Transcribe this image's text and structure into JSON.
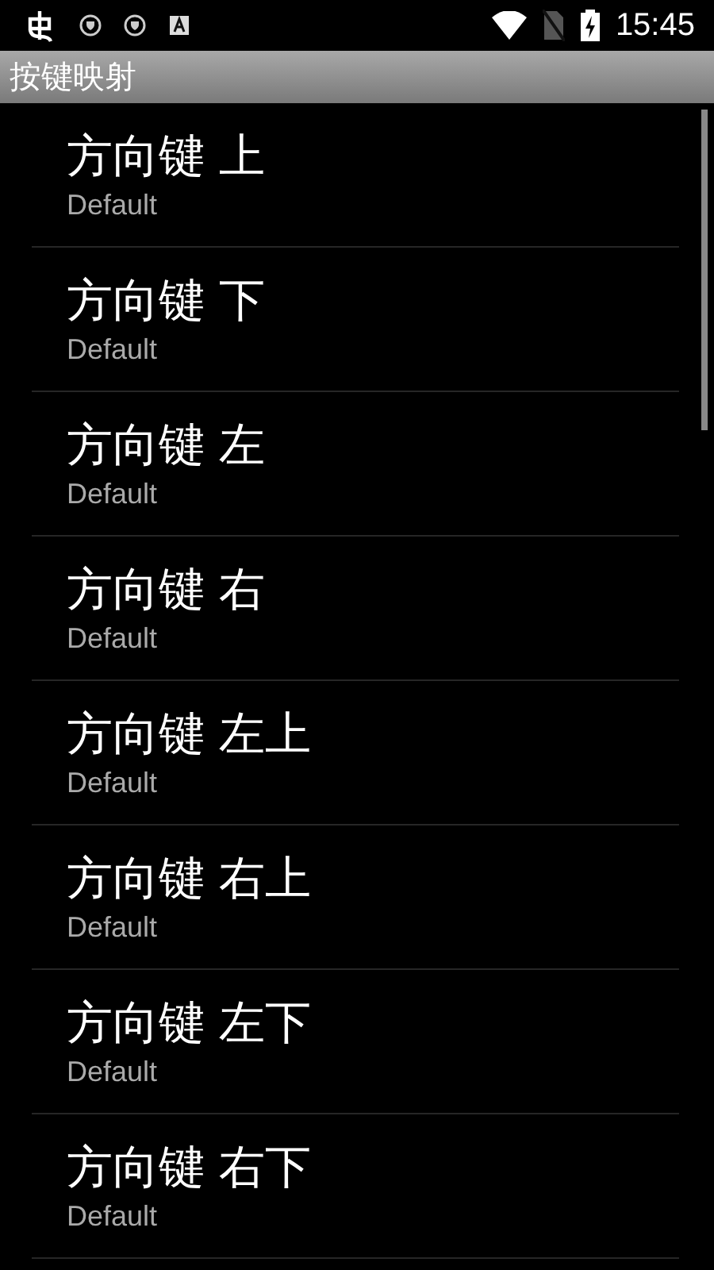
{
  "status_bar": {
    "time": "15:45"
  },
  "title_bar": {
    "title": "按键映射"
  },
  "items": [
    {
      "title": "方向键 上",
      "summary": "Default"
    },
    {
      "title": "方向键 下",
      "summary": "Default"
    },
    {
      "title": "方向键 左",
      "summary": "Default"
    },
    {
      "title": "方向键 右",
      "summary": "Default"
    },
    {
      "title": "方向键 左上",
      "summary": "Default"
    },
    {
      "title": "方向键 右上",
      "summary": "Default"
    },
    {
      "title": "方向键 左下",
      "summary": "Default"
    },
    {
      "title": "方向键 右下",
      "summary": "Default"
    }
  ]
}
